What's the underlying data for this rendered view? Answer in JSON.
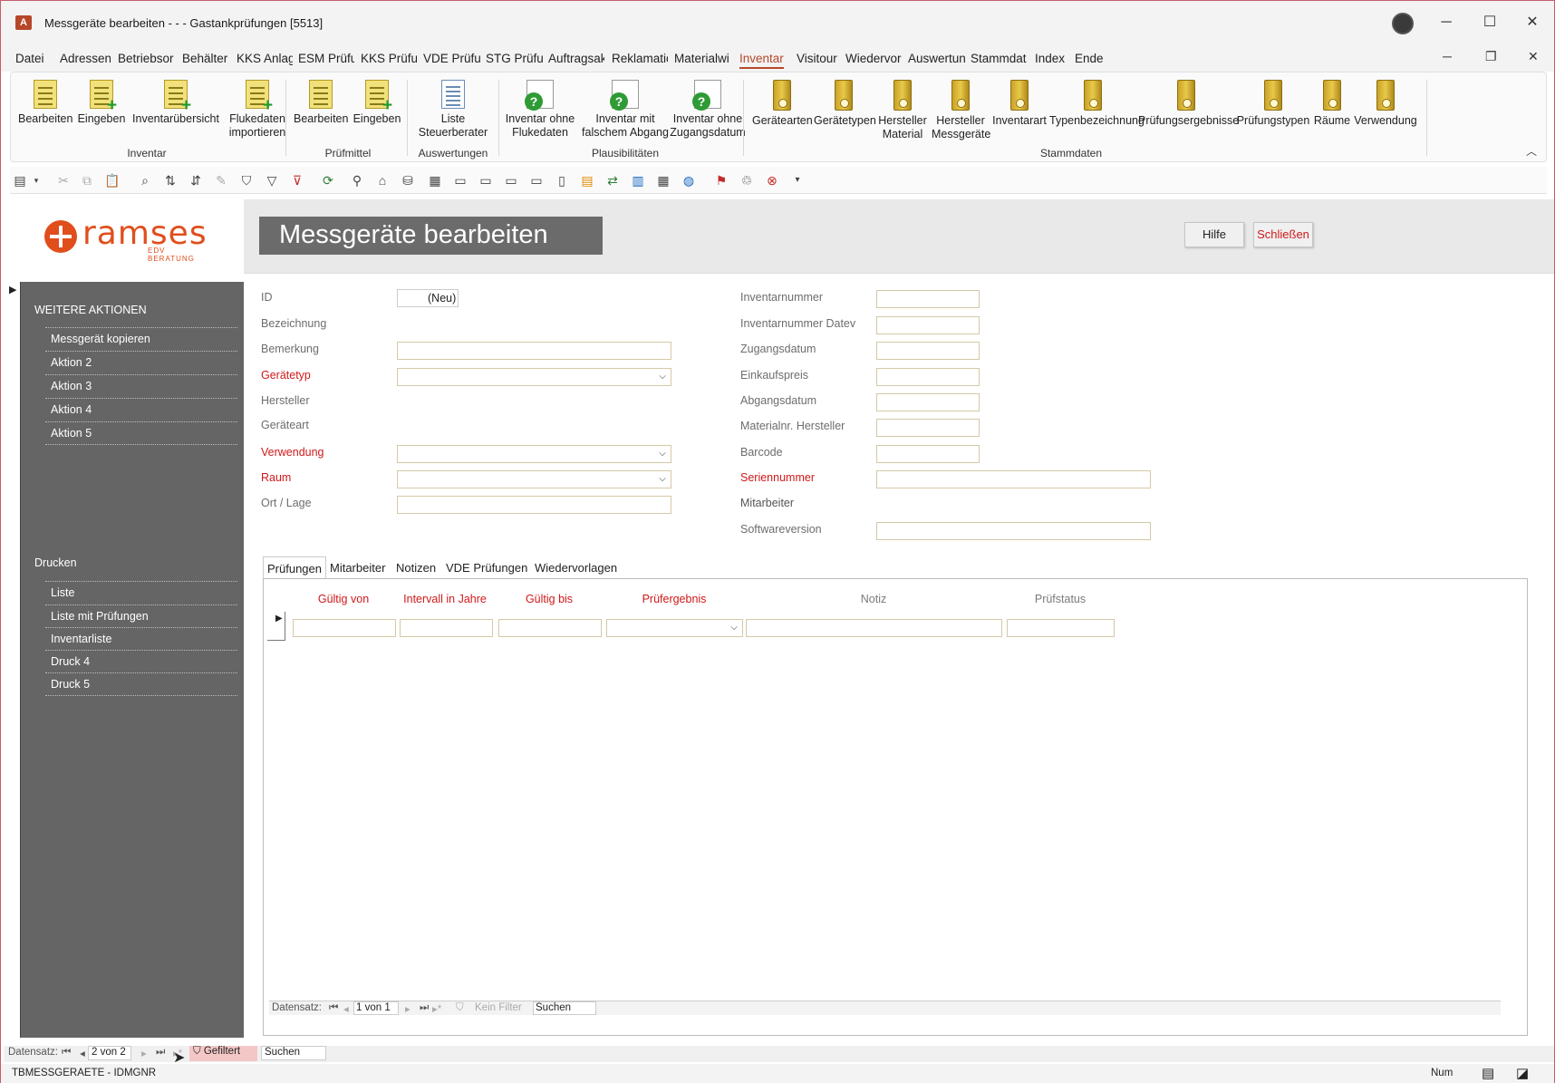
{
  "window": {
    "app_icon": "A",
    "title": "Messgeräte bearbeiten -  -  -  Gastankprüfungen [5513]"
  },
  "menu": [
    "Datei",
    "Adressen",
    "Betriebsor",
    "Behälter",
    "KKS Anlag",
    "ESM Prüfu",
    "KKS Prüfur",
    "VDE Prüfu",
    "STG Prüfur",
    "Auftragsak",
    "Reklamatic",
    "Materialwi",
    "Inventar",
    "Visitour",
    "Wiedervor",
    "Auswertun",
    "Stammdat",
    "Index",
    "Ende"
  ],
  "menu_active": "Inventar",
  "ribbon": {
    "inventar": {
      "label": "Inventar",
      "b1": "Bearbeiten",
      "b2": "Eingeben",
      "b3": "Inventarübersicht",
      "b4a": "Flukedaten",
      "b4b": "importieren"
    },
    "pruefmittel": {
      "label": "Prüfmittel",
      "b1": "Bearbeiten",
      "b2": "Eingeben"
    },
    "auswertungen": {
      "label": "Auswertungen",
      "b1a": "Liste",
      "b1b": "Steuerberater"
    },
    "plausi": {
      "label": "Plausibilitäten",
      "b1a": "Inventar ohne",
      "b1b": "Flukedaten",
      "b2a": "Inventar mit",
      "b2b": "falschem Abgang",
      "b3a": "Inventar ohne",
      "b3b": "Zugangsdatum"
    },
    "stammdaten": {
      "label": "Stammdaten",
      "b1": "Gerätearten",
      "b2": "Gerätetypen",
      "b3a": "Hersteller",
      "b3b": "Material",
      "b4a": "Hersteller",
      "b4b": "Messgeräte",
      "b5": "Inventarart",
      "b6": "Typenbezeichnung",
      "b7": "Prüfungsergebnisse",
      "b8": "Prüfungstypen",
      "b9": "Räume",
      "b10": "Verwendung"
    }
  },
  "form": {
    "logo_name": "ramses",
    "logo_sub": "EDV BERATUNG",
    "title": "Messgeräte bearbeiten",
    "help_button": "Hilfe",
    "close_button": "Schließen",
    "colors": {
      "accent": "#d0191a",
      "sidebar": "#656565",
      "header_box": "#6b6b6b",
      "logo": "#e04e1c"
    }
  },
  "sidebar": {
    "section1": "WEITERE AKTIONEN",
    "actions": [
      "Messgerät kopieren",
      "Aktion 2",
      "Aktion 3",
      "Aktion 4",
      "Aktion 5"
    ],
    "section2": "Drucken",
    "prints": [
      "Liste",
      "Liste mit Prüfungen",
      "Inventarliste",
      "Druck 4",
      "Druck 5"
    ]
  },
  "fields_left": {
    "id_label": "ID",
    "id_value": "(Neu)",
    "bezeichnung": "Bezeichnung",
    "bemerkung": "Bemerkung",
    "geraetetyp": "Gerätetyp",
    "hersteller": "Hersteller",
    "geraeteart": "Geräteart",
    "verwendung": "Verwendung",
    "raum": "Raum",
    "ort": "Ort / Lage"
  },
  "fields_right": {
    "inventarnummer": "Inventarnummer",
    "inventarnummer_datev": "Inventarnummer Datev",
    "zugangsdatum": "Zugangsdatum",
    "einkaufspreis": "Einkaufspreis",
    "abgangsdatum": "Abgangsdatum",
    "materialnr": "Materialnr. Hersteller",
    "barcode": "Barcode",
    "seriennummer": "Seriennummer",
    "mitarbeiter": "Mitarbeiter",
    "softwareversion": "Softwareversion"
  },
  "tabs": [
    "Prüfungen",
    "Mitarbeiter",
    "Notizen",
    "VDE Prüfungen",
    "Wiedervorlagen"
  ],
  "subform": {
    "columns": [
      "Gültig von",
      "Intervall in Jahre",
      "Gültig bis",
      "Prüfergebnis",
      "Notiz",
      "Prüfstatus"
    ],
    "nav_label": "Datensatz:",
    "nav_record": "1 von 1",
    "nav_filter": "Kein Filter",
    "nav_search": "Suchen"
  },
  "main_nav": {
    "label": "Datensatz:",
    "record": "2 von 2",
    "filter": "Gefiltert",
    "search": "Suchen"
  },
  "statusbar": {
    "left": "TBMESSGERAETE - IDMGNR",
    "num": "Num"
  }
}
